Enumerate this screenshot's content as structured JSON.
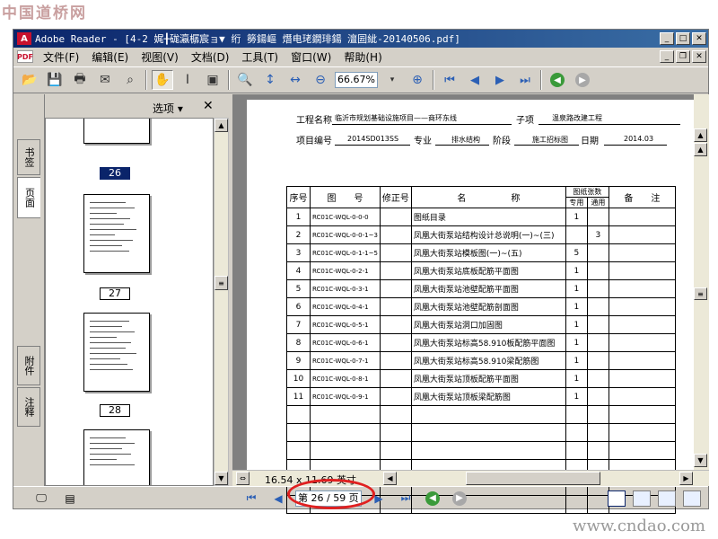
{
  "watermark_top": "中国道桥网",
  "watermark_bottom": "www.cndao.com",
  "window": {
    "title": "Adobe Reader - [4-2 娓╂硥瀛樼宸ョ▼ 绗   簩鍚嶇 熸电珯鐗琲鍚     澶囩紪-20140506.pdf]",
    "logo_text": "A"
  },
  "menus": [
    "文件(F)",
    "编辑(E)",
    "视图(V)",
    "文档(D)",
    "工具(T)",
    "窗口(W)",
    "帮助(H)"
  ],
  "toolbar": {
    "zoom": "66.67%"
  },
  "left_tabs": {
    "bookmarks": "书签",
    "pages": "页面",
    "attachments": "附件",
    "comments": "注释"
  },
  "thumbnails": {
    "options_label": "选项 ▾",
    "close": "✕",
    "pages": [
      "26",
      "27",
      "28"
    ]
  },
  "doc": {
    "size_readout": "16.54 x 11.69 英寸",
    "header": {
      "project_name_label": "工程名称",
      "project_name_value": "临沂市规划基础设施项目——商环东线",
      "subitem_label": "子项",
      "subitem_value": "温泉路改建工程",
      "project_no_label": "项目编号",
      "project_no_value": "2014SD013SS",
      "specialty_label": "专业",
      "specialty_value": "排水结构",
      "stage_label": "阶段",
      "stage_value": "施工招标图",
      "date_label": "日期",
      "date_value": "2014.03"
    },
    "table": {
      "headers": {
        "seq": "序号",
        "drawing_no": "图　　号",
        "revision": "修正号",
        "name": "名　　　　　称",
        "count_group": "图纸张数",
        "dedicated": "专用",
        "general": "通用",
        "remark": "备　　注"
      },
      "rows": [
        {
          "seq": "1",
          "no": "RC01C-WQL-0-0-0",
          "name": "图纸目录",
          "dedicated": "1",
          "general": ""
        },
        {
          "seq": "2",
          "no": "RC01C-WQL-0-0-1~3",
          "name": "凤凰大街泵站结构设计总说明(一)~(三)",
          "dedicated": "",
          "general": "3"
        },
        {
          "seq": "3",
          "no": "RC01C-WQL-0-1-1~5",
          "name": "凤凰大街泵站模板图(一)~(五)",
          "dedicated": "5",
          "general": ""
        },
        {
          "seq": "4",
          "no": "RC01C-WQL-0-2-1",
          "name": "凤凰大街泵站底板配筋平面图",
          "dedicated": "1",
          "general": ""
        },
        {
          "seq": "5",
          "no": "RC01C-WQL-0-3-1",
          "name": "凤凰大街泵站池壁配筋平面图",
          "dedicated": "1",
          "general": ""
        },
        {
          "seq": "6",
          "no": "RC01C-WQL-0-4-1",
          "name": "凤凰大街泵站池壁配筋剖面图",
          "dedicated": "1",
          "general": ""
        },
        {
          "seq": "7",
          "no": "RC01C-WQL-0-5-1",
          "name": "凤凰大街泵站洞口加固图",
          "dedicated": "1",
          "general": ""
        },
        {
          "seq": "8",
          "no": "RC01C-WQL-0-6-1",
          "name": "凤凰大街泵站标高58.910板配筋平面图",
          "dedicated": "1",
          "general": ""
        },
        {
          "seq": "9",
          "no": "RC01C-WQL-0-7-1",
          "name": "凤凰大街泵站标高58.910梁配筋图",
          "dedicated": "1",
          "general": ""
        },
        {
          "seq": "10",
          "no": "RC01C-WQL-0-8-1",
          "name": "凤凰大街泵站顶板配筋平面图",
          "dedicated": "1",
          "general": ""
        },
        {
          "seq": "11",
          "no": "RC01C-WQL-0-9-1",
          "name": "凤凰大街泵站顶板梁配筋图",
          "dedicated": "1",
          "general": ""
        }
      ],
      "empty_rows": 6
    }
  },
  "status": {
    "page_indicator": "第 26 / 59 页"
  }
}
